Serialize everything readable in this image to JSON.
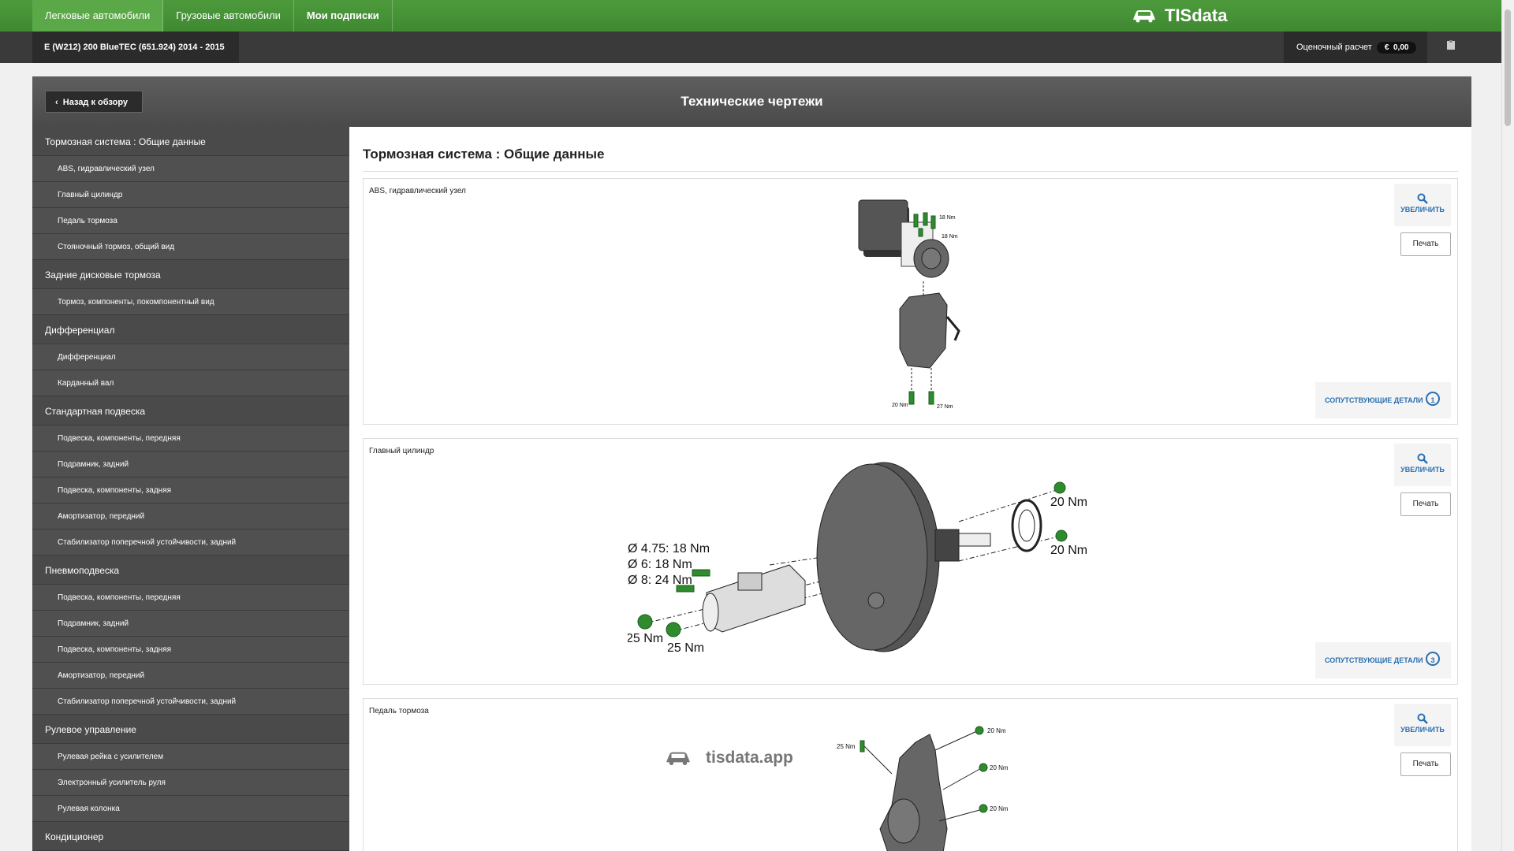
{
  "topnav": {
    "tabs": [
      {
        "label": "Легковые автомобили"
      },
      {
        "label": "Грузовые автомобили"
      },
      {
        "label": "Мои подписки"
      }
    ],
    "brand": "TISdata"
  },
  "subbar": {
    "vehicle": "E (W212) 200 BlueTEC (651.924) 2014 - 2015",
    "estimate_label": "Оценочный расчет",
    "currency": "€",
    "amount": "0,00"
  },
  "header": {
    "back_label": "Назад к обзору",
    "title": "Технические чертежи"
  },
  "sidebar": {
    "groups": [
      {
        "title": "Тормозная система : Общие данные",
        "items": [
          "ABS, гидравлический узел",
          "Главный цилиндр",
          "Педаль тормоза",
          "Стояночный тормоз, общий вид"
        ]
      },
      {
        "title": "Задние дисковые тормоза",
        "items": [
          "Тормоз, компоненты, покомпонентный вид"
        ]
      },
      {
        "title": "Дифференциал",
        "items": [
          "Дифференциал",
          "Карданный вал"
        ]
      },
      {
        "title": "Стандартная подвеска",
        "items": [
          "Подвеска, компоненты, передняя",
          "Подрамник, задний",
          "Подвеска, компоненты, задняя",
          "Амортизатор, передний",
          "Стабилизатор поперечной устойчивости, задний"
        ]
      },
      {
        "title": "Пневмоподвеска",
        "items": [
          "Подвеска, компоненты, передняя",
          "Подрамник, задний",
          "Подвеска, компоненты, задняя",
          "Амортизатор, передний",
          "Стабилизатор поперечной устойчивости, задний"
        ]
      },
      {
        "title": "Рулевое управление",
        "items": [
          "Рулевая рейка с усилителем",
          "Электронный усилитель руля",
          "Рулевая колонка"
        ]
      },
      {
        "title": "Кондиционер",
        "items": []
      }
    ]
  },
  "main": {
    "section_title": "Тормозная система : Общие данные",
    "zoom_label": "УВЕЛИЧИТЬ",
    "print_label": "Печать",
    "related_label": "СОПУТСТВУЮЩИЕ ДЕТАЛИ",
    "cards": [
      {
        "label": "ABS, гидравлический узел",
        "related_count": "1",
        "torques": [
          "18 Nm",
          "18 Nm",
          "20 Nm",
          "27 Nm"
        ]
      },
      {
        "label": "Главный цилиндр",
        "related_count": "3",
        "torques": [
          "Ø 4.75: 18 Nm",
          "Ø 6: 18 Nm",
          "Ø 8: 24 Nm",
          "25 Nm",
          "25 Nm",
          "20 Nm",
          "20 Nm"
        ]
      },
      {
        "label": "Педаль тормоза",
        "torques": [
          "25 Nm",
          "20 Nm",
          "20 Nm",
          "20 Nm"
        ]
      }
    ],
    "watermark": "tisdata.app"
  },
  "colors": {
    "brand_green": "#4d9a3c",
    "link_blue": "#2a6fb0",
    "bolt_green": "#2e8b2e"
  }
}
